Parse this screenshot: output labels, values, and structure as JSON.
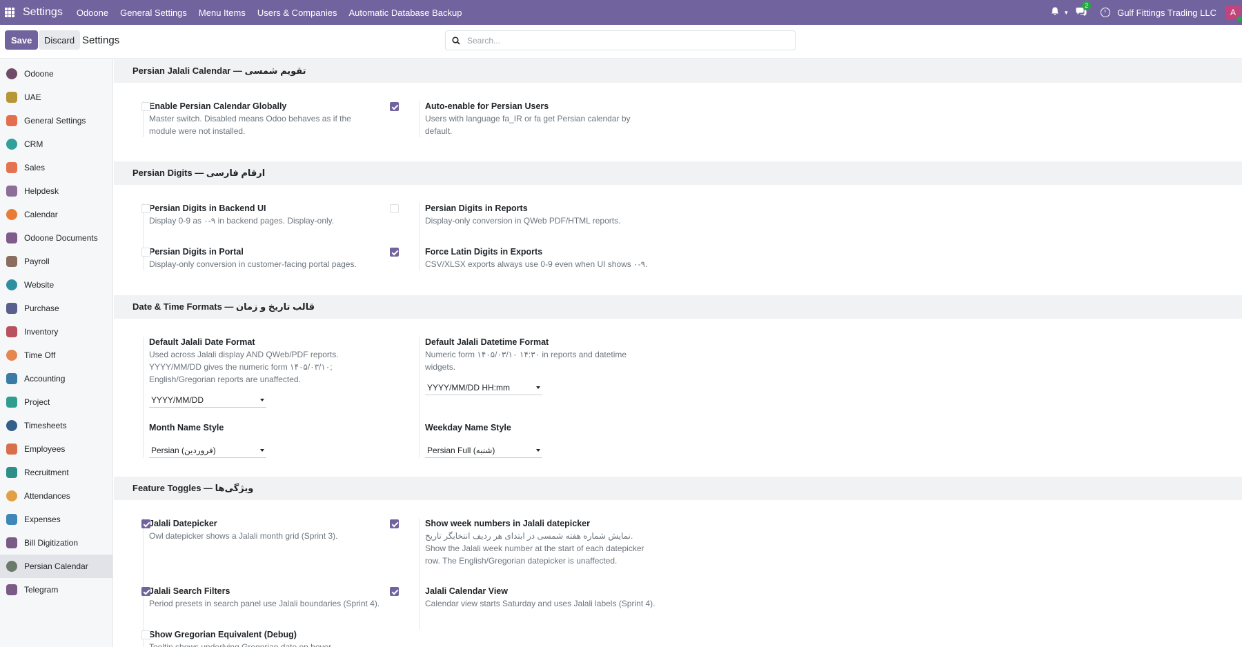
{
  "navbar": {
    "brand": "Settings",
    "menu": [
      "Odoone",
      "General Settings",
      "Menu Items",
      "Users & Companies",
      "Automatic Database Backup"
    ],
    "chat_count": "2",
    "company": "Gulf Fittings Trading LLC",
    "avatar_letter": "A"
  },
  "control": {
    "save_label": "Save",
    "discard_label": "Discard",
    "title": "Settings",
    "search_placeholder": "Search..."
  },
  "sidebar": {
    "active": "Persian Calendar",
    "items": [
      {
        "label": "Odoone",
        "icon": "odoone-icon",
        "color": "#714b67"
      },
      {
        "label": "UAE",
        "icon": "pin-icon",
        "color": "#b79636"
      },
      {
        "label": "General Settings",
        "icon": "settings-icon",
        "color": "#e46f4e"
      },
      {
        "label": "CRM",
        "icon": "crm-icon",
        "color": "#2fa09a"
      },
      {
        "label": "Sales",
        "icon": "sales-icon",
        "color": "#e4734f"
      },
      {
        "label": "Helpdesk",
        "icon": "helpdesk-icon",
        "color": "#8d6e99"
      },
      {
        "label": "Calendar",
        "icon": "calendar-icon",
        "color": "#e87b35"
      },
      {
        "label": "Odoone Documents",
        "icon": "documents-icon",
        "color": "#805c8c"
      },
      {
        "label": "Payroll",
        "icon": "payroll-icon",
        "color": "#8a6d5e"
      },
      {
        "label": "Website",
        "icon": "website-icon",
        "color": "#2e8fa0"
      },
      {
        "label": "Purchase",
        "icon": "purchase-icon",
        "color": "#5a5f8e"
      },
      {
        "label": "Inventory",
        "icon": "inventory-icon",
        "color": "#b9515f"
      },
      {
        "label": "Time Off",
        "icon": "timeoff-icon",
        "color": "#e5874e"
      },
      {
        "label": "Accounting",
        "icon": "accounting-icon",
        "color": "#3a7ca5"
      },
      {
        "label": "Project",
        "icon": "project-icon",
        "color": "#2f9d8f"
      },
      {
        "label": "Timesheets",
        "icon": "timesheets-icon",
        "color": "#355f8b"
      },
      {
        "label": "Employees",
        "icon": "employees-icon",
        "color": "#d86e4a"
      },
      {
        "label": "Recruitment",
        "icon": "recruitment-icon",
        "color": "#2c8f88"
      },
      {
        "label": "Attendances",
        "icon": "attendances-icon",
        "color": "#e2a043"
      },
      {
        "label": "Expenses",
        "icon": "expenses-icon",
        "color": "#3f87b7"
      },
      {
        "label": "Bill Digitization",
        "icon": "bill-digitization-icon",
        "color": "#7a5a86"
      },
      {
        "label": "Persian Calendar",
        "icon": "persian-calendar-icon",
        "color": "#6b7b6b"
      },
      {
        "label": "Telegram",
        "icon": "telegram-icon",
        "color": "#7a5a86"
      }
    ]
  },
  "sections": [
    {
      "title": "Persian Jalali Calendar — تقویم شمسی",
      "settings": [
        {
          "title": "Enable Persian Calendar Globally",
          "desc": "Master switch. Disabled means Odoo behaves as if the module were not installed.",
          "checked": false
        },
        {
          "title": "Auto-enable for Persian Users",
          "desc": "Users with language fa_IR or fa get Persian calendar by default.",
          "checked": true
        }
      ]
    },
    {
      "title": "Persian Digits — ارقام فارسی",
      "settings": [
        {
          "title": "Persian Digits in Backend UI",
          "desc": "Display 0-9 as ۰-۹ in backend pages. Display-only.",
          "checked": false
        },
        {
          "title": "Persian Digits in Reports",
          "desc": "Display-only conversion in QWeb PDF/HTML reports.",
          "checked": false
        },
        {
          "title": "Persian Digits in Portal",
          "desc": "Display-only conversion in customer-facing portal pages.",
          "checked": false
        },
        {
          "title": "Force Latin Digits in Exports",
          "desc": "CSV/XLSX exports always use 0-9 even when UI shows ۰-۹.",
          "checked": true
        }
      ]
    },
    {
      "title": "Date & Time Formats — قالب تاریخ و زمان",
      "settings": [
        {
          "title": "Default Jalali Date Format",
          "desc": "Used across Jalali display AND QWeb/PDF reports. YYYY/MM/DD gives the numeric form ۱۴۰۵/۰۳/۱۰; English/Gregorian reports are unaffected.",
          "value": "YYYY/MM/DD"
        },
        {
          "title": "Default Jalali Datetime Format",
          "desc": "Numeric form ۱۴۰۵/۰۳/۱۰ ۱۴:۳۰ in reports and datetime widgets.",
          "value": "YYYY/MM/DD HH:mm"
        },
        {
          "title": "Month Name Style",
          "desc": "",
          "value": "Persian (فروردین)"
        },
        {
          "title": "Weekday Name Style",
          "desc": "",
          "value": "Persian Full (شنبه)"
        }
      ]
    },
    {
      "title": "Feature Toggles — ویژگی‌ها",
      "settings": [
        {
          "title": "Jalali Datepicker",
          "desc": "Owl datepicker shows a Jalali month grid (Sprint 3).",
          "checked": true
        },
        {
          "title": "Show week numbers in Jalali datepicker",
          "desc": "نمایش شماره هفته شمسی در ابتدای هر ردیف انتخابگر تاریخ. Show the Jalali week number at the start of each datepicker row. The English/Gregorian datepicker is unaffected.",
          "checked": true
        },
        {
          "title": "Jalali Search Filters",
          "desc": "Period presets in search panel use Jalali boundaries (Sprint 4).",
          "checked": true
        },
        {
          "title": "Jalali Calendar View",
          "desc": "Calendar view starts Saturday and uses Jalali labels (Sprint 4).",
          "checked": true
        },
        {
          "title": "Show Gregorian Equivalent (Debug)",
          "desc": "Tooltip shows underlying Gregorian date on hover.",
          "checked": false
        }
      ]
    }
  ],
  "colors": {
    "brand": "#71639e",
    "checked": "#71639e",
    "section_bg": "#f1f2f4"
  }
}
